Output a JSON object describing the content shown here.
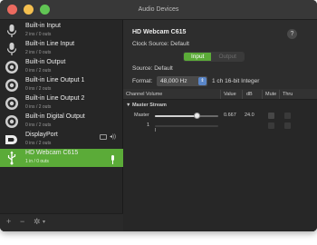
{
  "window": {
    "title": "Audio Devices"
  },
  "sidebar": {
    "devices": [
      {
        "name": "Built-in Input",
        "io": "2 ins / 0 outs",
        "icon": "microphone-icon"
      },
      {
        "name": "Built-in Line Input",
        "io": "2 ins / 0 outs",
        "icon": "microphone-icon"
      },
      {
        "name": "Built-in Output",
        "io": "0 ins / 2 outs",
        "icon": "speaker-icon"
      },
      {
        "name": "Built-in Line Output 1",
        "io": "0 ins / 2 outs",
        "icon": "speaker-icon"
      },
      {
        "name": "Built-in Line Output 2",
        "io": "0 ins / 2 outs",
        "icon": "speaker-icon"
      },
      {
        "name": "Built-in Digital Output",
        "io": "0 ins / 2 outs",
        "icon": "speaker-icon"
      },
      {
        "name": "DisplayPort",
        "io": "0 ins / 2 outs",
        "icon": "displayport-icon"
      },
      {
        "name": "HD Webcam C615",
        "io": "1 in / 0 outs",
        "icon": "usb-icon",
        "selected": true
      }
    ],
    "bottom": {
      "add": "+",
      "remove": "−",
      "gear": "✲",
      "chevron": "▾"
    }
  },
  "main": {
    "device_title": "HD Webcam C615",
    "help": "?",
    "clock_source_label": "Clock Source:",
    "clock_source_value": "Default",
    "segments": {
      "input": "Input",
      "output": "Output"
    },
    "source_label": "Source:",
    "source_value": "Default",
    "format_label": "Format:",
    "format_value": "48,000 Hz",
    "format_desc": "1 ch 16-bit Integer",
    "table": {
      "headers": {
        "channel_volume": "Channel Volume",
        "value": "Value",
        "db": "dB",
        "mute": "Mute",
        "thru": "Thru"
      },
      "group": "▼ Master Stream",
      "rows": [
        {
          "label": "Master",
          "level": 0.667,
          "value": "0.667",
          "db": "24.0"
        },
        {
          "label": "1",
          "level": 0.0,
          "value": "",
          "db": ""
        }
      ]
    }
  },
  "colors": {
    "accent": "#5bab38",
    "window_bg": "#2b2b2b"
  }
}
